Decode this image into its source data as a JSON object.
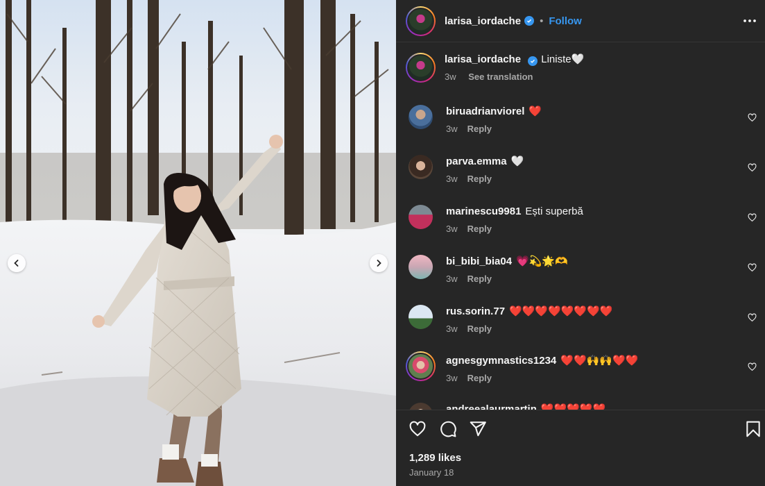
{
  "post": {
    "username": "larisa_iordache",
    "follow_label": "Follow",
    "dot": "•",
    "caption": "Liniste🤍",
    "caption_age": "3w",
    "see_translation": "See translation"
  },
  "comments": [
    {
      "user": "biruadrianviorel",
      "text": "❤️",
      "age": "3w",
      "reply": "Reply"
    },
    {
      "user": "parva.emma",
      "text": "🤍",
      "age": "3w",
      "reply": "Reply"
    },
    {
      "user": "marinescu9981",
      "text": "Ești superbă",
      "age": "3w",
      "reply": "Reply"
    },
    {
      "user": "bi_bibi_bia04",
      "text": "💗💫🌟🫶",
      "age": "3w",
      "reply": "Reply"
    },
    {
      "user": "rus.sorin.77",
      "text": "❤️❤️❤️❤️❤️❤️❤️❤️",
      "age": "3w",
      "reply": "Reply"
    },
    {
      "user": "agnesgymnastics1234",
      "text": "❤️❤️🙌🙌❤️❤️",
      "age": "3w",
      "reply": "Reply"
    },
    {
      "user": "andreealaurmartin",
      "text": "❤️❤️❤️❤️❤️"
    }
  ],
  "footer": {
    "likes": "1,289 likes",
    "date": "January 18"
  },
  "icons": {
    "verified": "verified-badge-icon",
    "more": "more-options-icon",
    "like": "heart-icon",
    "comment": "comment-bubble-icon",
    "share": "paper-plane-icon",
    "save": "bookmark-icon",
    "prev": "chevron-left-icon",
    "next": "chevron-right-icon"
  },
  "colors": {
    "panel_bg": "#262626",
    "link_blue": "#3797f0",
    "muted_text": "#a8a8a8",
    "heart_red": "#ed4956"
  }
}
